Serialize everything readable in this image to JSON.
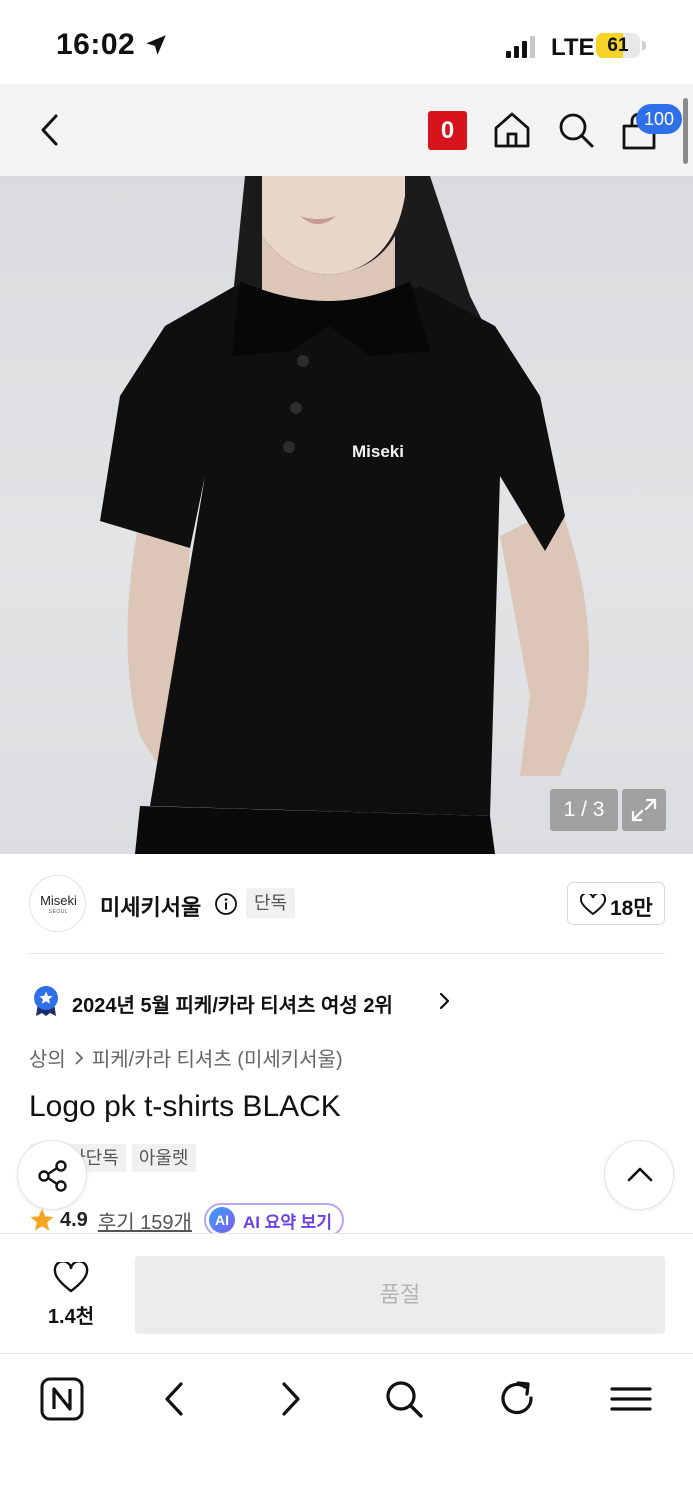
{
  "status_bar": {
    "time": "16:02",
    "network": "LTE",
    "battery": "61",
    "battery_level": 0.61,
    "icons": [
      "location-arrow-icon",
      "cellular-signal-icon"
    ]
  },
  "top_nav": {
    "badge": "0",
    "cart_count": "100",
    "icons": [
      "back-icon",
      "home-icon",
      "search-icon",
      "shopping-bag-icon"
    ]
  },
  "gallery": {
    "image_logo_text": "Miseki",
    "counter": "1 / 3",
    "current_index": 1,
    "total": 3,
    "icons": [
      "expand-icon"
    ]
  },
  "brand": {
    "logo_text": "Miseki",
    "logo_sub": "SEOUL",
    "name": "미세키서울",
    "exclusive_tag": "단독",
    "like_count": "18만",
    "icons": [
      "info-icon",
      "heart-icon"
    ]
  },
  "ranking": {
    "text": "2024년 5월 피케/카라 티셔츠 여성 2위",
    "icons": [
      "ranking-medal-icon",
      "chevron-right-icon"
    ]
  },
  "breadcrumb": {
    "items": [
      "상의",
      "피케/카라 티셔츠 (미세키서울)"
    ]
  },
  "product": {
    "title": "Logo pk t-shirts BLACK",
    "tags": [
      "무신사단독",
      "아울렛"
    ],
    "rating": "4.9",
    "review_link": "후기 159개",
    "ai_badge": "AI",
    "ai_summary_label": "AI 요약 보기"
  },
  "purchase_bar": {
    "wish_count": "1.4천",
    "buy_button": "품절"
  },
  "browser_toolbar": {
    "icons": [
      "naver-home-icon",
      "browser-back-icon",
      "browser-forward-icon",
      "browser-search-icon",
      "refresh-icon",
      "menu-icon"
    ]
  },
  "colors": {
    "badge_red": "#d7141c",
    "cart_blue": "#2f6fe8",
    "battery_yellow": "#f5d327",
    "rank_blue": "#2f6fe8",
    "star_orange": "#f5a623",
    "ai_purple": "#6b3fe0"
  }
}
